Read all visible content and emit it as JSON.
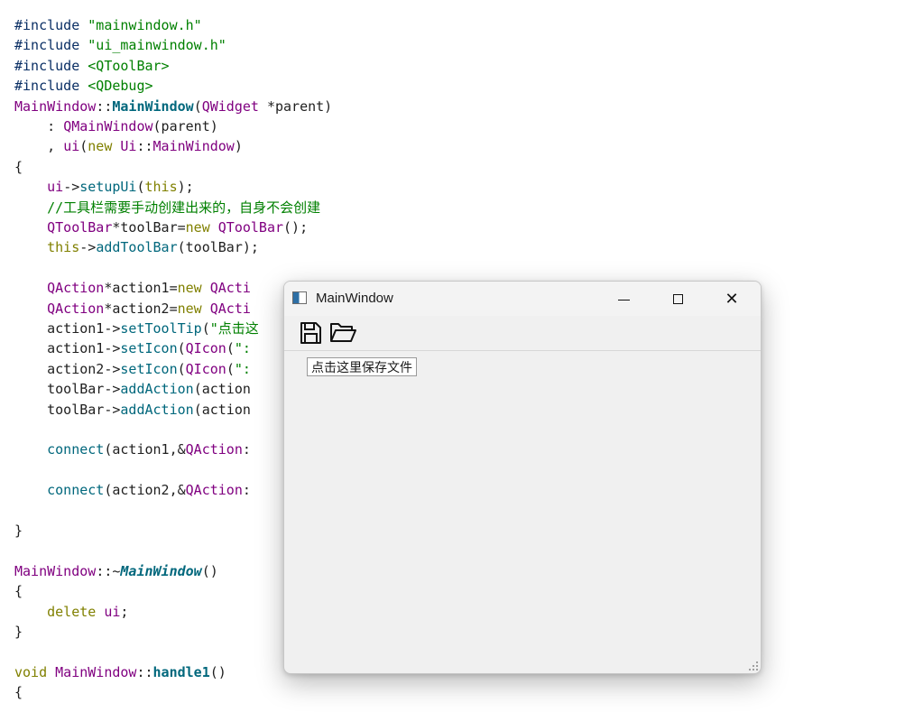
{
  "editor": {
    "lines": [
      [
        {
          "t": "#include ",
          "c": "t-var"
        },
        {
          "t": "\"mainwindow.h\"",
          "c": "t-str"
        }
      ],
      [
        {
          "t": "#include ",
          "c": "t-var"
        },
        {
          "t": "\"ui_mainwindow.h\"",
          "c": "t-str"
        }
      ],
      [
        {
          "t": "#include ",
          "c": "t-var"
        },
        {
          "t": "<QToolBar>",
          "c": "t-str"
        }
      ],
      [
        {
          "t": "#include ",
          "c": "t-var"
        },
        {
          "t": "<QDebug>",
          "c": "t-str"
        }
      ],
      [
        {
          "t": "MainWindow",
          "c": "t-cls"
        },
        {
          "t": "::",
          "c": ""
        },
        {
          "t": "MainWindow",
          "c": "t-bold"
        },
        {
          "t": "(",
          "c": ""
        },
        {
          "t": "QWidget",
          "c": "t-cls"
        },
        {
          "t": " *parent)",
          "c": ""
        }
      ],
      [
        {
          "t": "    : ",
          "c": ""
        },
        {
          "t": "QMainWindow",
          "c": "t-cls"
        },
        {
          "t": "(parent)",
          "c": ""
        }
      ],
      [
        {
          "t": "    , ",
          "c": ""
        },
        {
          "t": "ui",
          "c": "t-cls"
        },
        {
          "t": "(",
          "c": ""
        },
        {
          "t": "new",
          "c": "t-kw"
        },
        {
          "t": " ",
          "c": ""
        },
        {
          "t": "Ui",
          "c": "t-cls"
        },
        {
          "t": "::",
          "c": ""
        },
        {
          "t": "MainWindow",
          "c": "t-cls"
        },
        {
          "t": ")",
          "c": ""
        }
      ],
      [
        {
          "t": "{",
          "c": ""
        }
      ],
      [
        {
          "t": "    ",
          "c": ""
        },
        {
          "t": "ui",
          "c": "t-cls"
        },
        {
          "t": "->",
          "c": ""
        },
        {
          "t": "setupUi",
          "c": "t-fn"
        },
        {
          "t": "(",
          "c": ""
        },
        {
          "t": "this",
          "c": "t-kw"
        },
        {
          "t": ");",
          "c": ""
        }
      ],
      [
        {
          "t": "    //工具栏需要手动创建出来的，自身不会创建",
          "c": "t-cmt"
        }
      ],
      [
        {
          "t": "    ",
          "c": ""
        },
        {
          "t": "QToolBar",
          "c": "t-cls"
        },
        {
          "t": "*toolBar=",
          "c": ""
        },
        {
          "t": "new",
          "c": "t-kw"
        },
        {
          "t": " ",
          "c": ""
        },
        {
          "t": "QToolBar",
          "c": "t-cls"
        },
        {
          "t": "();",
          "c": ""
        }
      ],
      [
        {
          "t": "    ",
          "c": ""
        },
        {
          "t": "this",
          "c": "t-kw"
        },
        {
          "t": "->",
          "c": ""
        },
        {
          "t": "addToolBar",
          "c": "t-fn"
        },
        {
          "t": "(toolBar);",
          "c": ""
        }
      ],
      [],
      [
        {
          "t": "    ",
          "c": ""
        },
        {
          "t": "QAction",
          "c": "t-cls"
        },
        {
          "t": "*action1=",
          "c": ""
        },
        {
          "t": "new",
          "c": "t-kw"
        },
        {
          "t": " QActi",
          "c": "t-cls"
        }
      ],
      [
        {
          "t": "    ",
          "c": ""
        },
        {
          "t": "QAction",
          "c": "t-cls"
        },
        {
          "t": "*action2=",
          "c": ""
        },
        {
          "t": "new",
          "c": "t-kw"
        },
        {
          "t": " QActi",
          "c": "t-cls"
        }
      ],
      [
        {
          "t": "    action1->",
          "c": ""
        },
        {
          "t": "setToolTip",
          "c": "t-fn"
        },
        {
          "t": "(",
          "c": ""
        },
        {
          "t": "\"点击这",
          "c": "t-str"
        }
      ],
      [
        {
          "t": "    action1->",
          "c": ""
        },
        {
          "t": "setIcon",
          "c": "t-fn"
        },
        {
          "t": "(",
          "c": ""
        },
        {
          "t": "QIcon",
          "c": "t-cls"
        },
        {
          "t": "(",
          "c": ""
        },
        {
          "t": "\":",
          "c": "t-str"
        }
      ],
      [
        {
          "t": "    action2->",
          "c": ""
        },
        {
          "t": "setIcon",
          "c": "t-fn"
        },
        {
          "t": "(",
          "c": ""
        },
        {
          "t": "QIcon",
          "c": "t-cls"
        },
        {
          "t": "(",
          "c": ""
        },
        {
          "t": "\":",
          "c": "t-str"
        }
      ],
      [
        {
          "t": "    toolBar->",
          "c": ""
        },
        {
          "t": "addAction",
          "c": "t-fn"
        },
        {
          "t": "(action",
          "c": ""
        }
      ],
      [
        {
          "t": "    toolBar->",
          "c": ""
        },
        {
          "t": "addAction",
          "c": "t-fn"
        },
        {
          "t": "(action",
          "c": ""
        }
      ],
      [],
      [
        {
          "t": "    ",
          "c": ""
        },
        {
          "t": "connect",
          "c": "t-fn"
        },
        {
          "t": "(action1,&",
          "c": ""
        },
        {
          "t": "QAction",
          "c": "t-cls"
        },
        {
          "t": ":",
          "c": ""
        }
      ],
      [],
      [
        {
          "t": "    ",
          "c": ""
        },
        {
          "t": "connect",
          "c": "t-fn"
        },
        {
          "t": "(action2,&",
          "c": ""
        },
        {
          "t": "QAction",
          "c": "t-cls"
        },
        {
          "t": ":",
          "c": ""
        }
      ],
      [],
      [
        {
          "t": "}",
          "c": ""
        }
      ],
      [],
      [
        {
          "t": "MainWindow",
          "c": "t-cls"
        },
        {
          "t": "::~",
          "c": ""
        },
        {
          "t": "MainWindow",
          "c": "t-ital"
        },
        {
          "t": "()",
          "c": ""
        }
      ],
      [
        {
          "t": "{",
          "c": ""
        }
      ],
      [
        {
          "t": "    ",
          "c": ""
        },
        {
          "t": "delete",
          "c": "t-kw"
        },
        {
          "t": " ",
          "c": ""
        },
        {
          "t": "ui",
          "c": "t-cls"
        },
        {
          "t": ";",
          "c": ""
        }
      ],
      [
        {
          "t": "}",
          "c": ""
        }
      ],
      [],
      [
        {
          "t": "void",
          "c": "t-kw"
        },
        {
          "t": " ",
          "c": ""
        },
        {
          "t": "MainWindow",
          "c": "t-cls"
        },
        {
          "t": "::",
          "c": ""
        },
        {
          "t": "handle1",
          "c": "t-bold"
        },
        {
          "t": "()",
          "c": ""
        }
      ],
      [
        {
          "t": "{",
          "c": ""
        }
      ]
    ]
  },
  "window": {
    "title": "MainWindow",
    "app_icon": "qt-app-window-icon",
    "controls": {
      "minimize_icon": "minimize-icon",
      "maximize_icon": "maximize-icon",
      "close_glyph": "✕"
    },
    "toolbar": {
      "actions": [
        {
          "name": "save-icon"
        },
        {
          "name": "open-folder-icon"
        }
      ]
    },
    "tooltip": "点击这里保存文件"
  }
}
